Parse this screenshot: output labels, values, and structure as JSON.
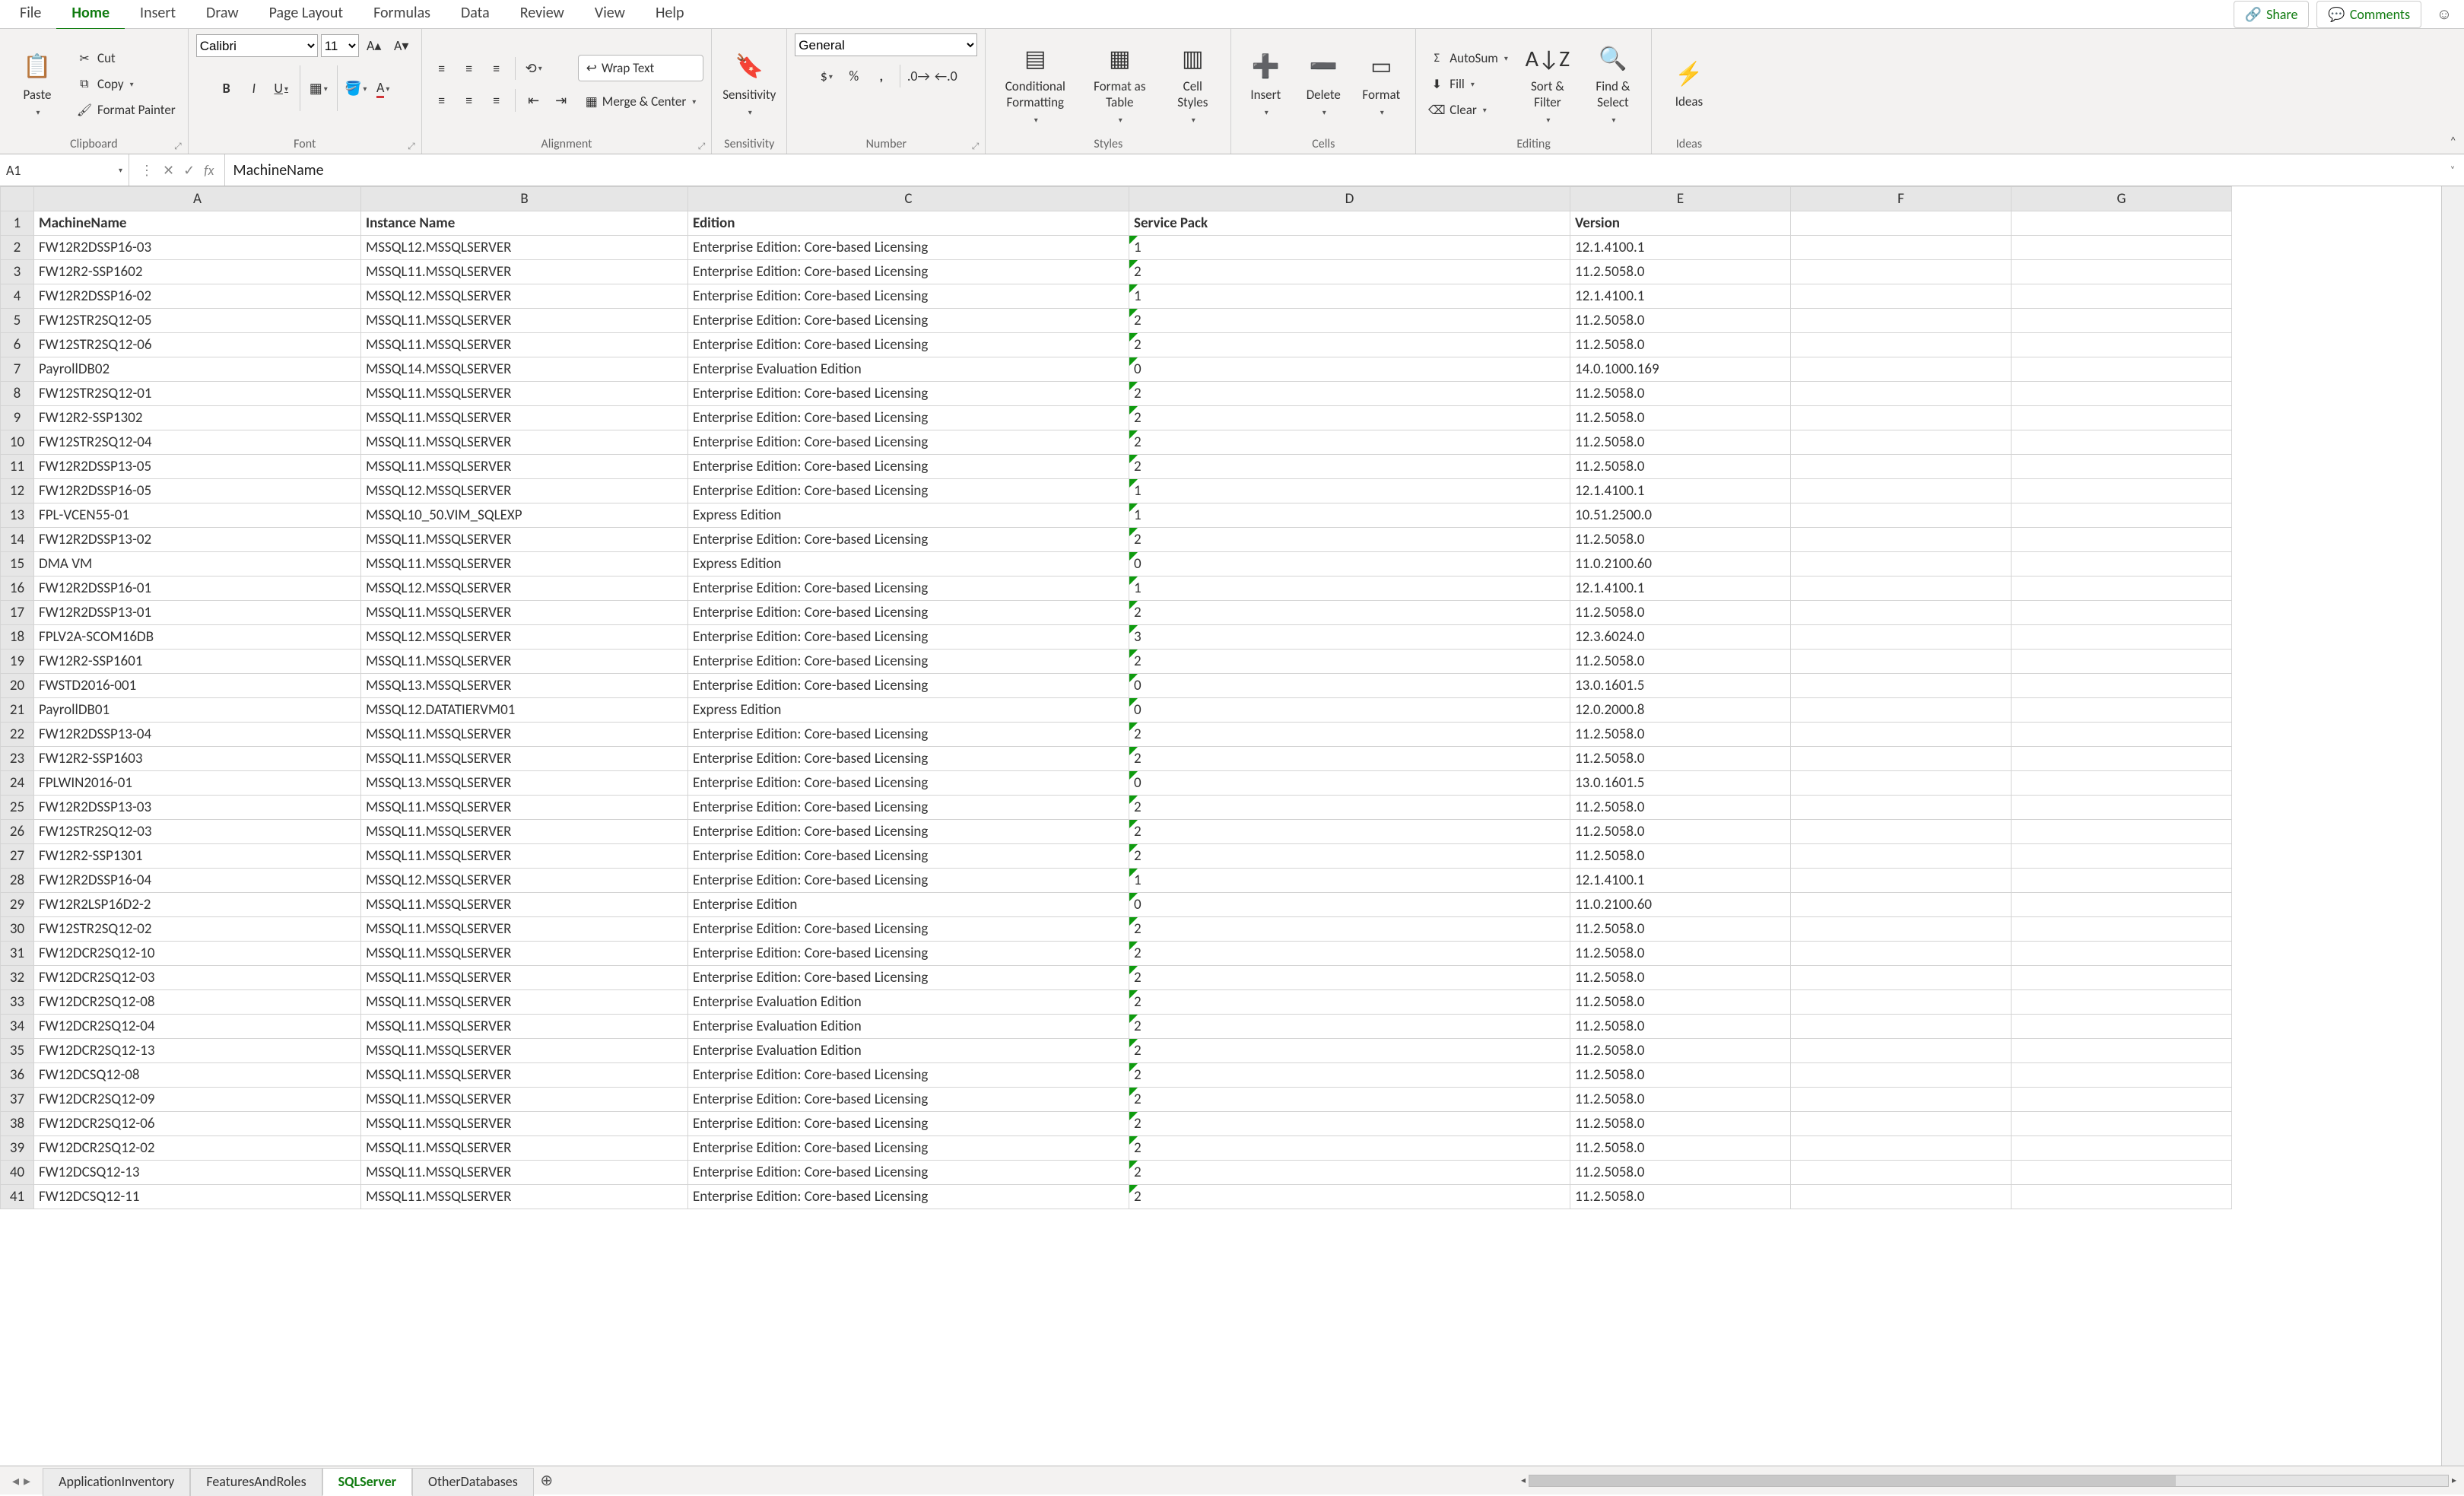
{
  "menu": {
    "tabs": [
      "File",
      "Home",
      "Insert",
      "Draw",
      "Page Layout",
      "Formulas",
      "Data",
      "Review",
      "View",
      "Help"
    ],
    "active": 1,
    "share": "Share",
    "comments": "Comments"
  },
  "ribbon": {
    "clipboard": {
      "title": "Clipboard",
      "paste": "Paste",
      "cut": "Cut",
      "copy": "Copy",
      "format_painter": "Format Painter"
    },
    "font": {
      "title": "Font",
      "name": "Calibri",
      "size": "11"
    },
    "alignment": {
      "title": "Alignment",
      "wrap": "Wrap Text",
      "merge": "Merge & Center"
    },
    "sensitivity": {
      "title": "Sensitivity",
      "label": "Sensitivity"
    },
    "number": {
      "title": "Number",
      "format": "General"
    },
    "styles": {
      "title": "Styles",
      "cond": "Conditional\nFormatting",
      "table": "Format as\nTable",
      "cell": "Cell\nStyles"
    },
    "cells": {
      "title": "Cells",
      "insert": "Insert",
      "delete": "Delete",
      "format": "Format"
    },
    "editing": {
      "title": "Editing",
      "sum": "AutoSum",
      "fill": "Fill",
      "clear": "Clear",
      "sort": "Sort &\nFilter",
      "find": "Find &\nSelect"
    },
    "ideas": {
      "title": "Ideas",
      "label": "Ideas"
    }
  },
  "formula_bar": {
    "cell_ref": "A1",
    "formula": "MachineName"
  },
  "columns": [
    "A",
    "B",
    "C",
    "D",
    "E",
    "F",
    "G"
  ],
  "headers": [
    "MachineName",
    "Instance Name",
    "Edition",
    "Service Pack",
    "Version"
  ],
  "rows": [
    [
      "FW12R2DSSP16-03",
      "MSSQL12.MSSQLSERVER",
      "Enterprise Edition: Core-based Licensing",
      "1",
      "12.1.4100.1"
    ],
    [
      "FW12R2-SSP1602",
      "MSSQL11.MSSQLSERVER",
      "Enterprise Edition: Core-based Licensing",
      "2",
      "11.2.5058.0"
    ],
    [
      "FW12R2DSSP16-02",
      "MSSQL12.MSSQLSERVER",
      "Enterprise Edition: Core-based Licensing",
      "1",
      "12.1.4100.1"
    ],
    [
      "FW12STR2SQ12-05",
      "MSSQL11.MSSQLSERVER",
      "Enterprise Edition: Core-based Licensing",
      "2",
      "11.2.5058.0"
    ],
    [
      "FW12STR2SQ12-06",
      "MSSQL11.MSSQLSERVER",
      "Enterprise Edition: Core-based Licensing",
      "2",
      "11.2.5058.0"
    ],
    [
      "PayrollDB02",
      "MSSQL14.MSSQLSERVER",
      "Enterprise Evaluation Edition",
      "0",
      "14.0.1000.169"
    ],
    [
      "FW12STR2SQ12-01",
      "MSSQL11.MSSQLSERVER",
      "Enterprise Edition: Core-based Licensing",
      "2",
      "11.2.5058.0"
    ],
    [
      "FW12R2-SSP1302",
      "MSSQL11.MSSQLSERVER",
      "Enterprise Edition: Core-based Licensing",
      "2",
      "11.2.5058.0"
    ],
    [
      "FW12STR2SQ12-04",
      "MSSQL11.MSSQLSERVER",
      "Enterprise Edition: Core-based Licensing",
      "2",
      "11.2.5058.0"
    ],
    [
      "FW12R2DSSP13-05",
      "MSSQL11.MSSQLSERVER",
      "Enterprise Edition: Core-based Licensing",
      "2",
      "11.2.5058.0"
    ],
    [
      "FW12R2DSSP16-05",
      "MSSQL12.MSSQLSERVER",
      "Enterprise Edition: Core-based Licensing",
      "1",
      "12.1.4100.1"
    ],
    [
      "FPL-VCEN55-01",
      "MSSQL10_50.VIM_SQLEXP",
      "Express Edition",
      "1",
      "10.51.2500.0"
    ],
    [
      "FW12R2DSSP13-02",
      "MSSQL11.MSSQLSERVER",
      "Enterprise Edition: Core-based Licensing",
      "2",
      "11.2.5058.0"
    ],
    [
      "DMA VM",
      "MSSQL11.MSSQLSERVER",
      "Express Edition",
      "0",
      "11.0.2100.60"
    ],
    [
      "FW12R2DSSP16-01",
      "MSSQL12.MSSQLSERVER",
      "Enterprise Edition: Core-based Licensing",
      "1",
      "12.1.4100.1"
    ],
    [
      "FW12R2DSSP13-01",
      "MSSQL11.MSSQLSERVER",
      "Enterprise Edition: Core-based Licensing",
      "2",
      "11.2.5058.0"
    ],
    [
      "FPLV2A-SCOM16DB",
      "MSSQL12.MSSQLSERVER",
      "Enterprise Edition: Core-based Licensing",
      "3",
      "12.3.6024.0"
    ],
    [
      "FW12R2-SSP1601",
      "MSSQL11.MSSQLSERVER",
      "Enterprise Edition: Core-based Licensing",
      "2",
      "11.2.5058.0"
    ],
    [
      "FWSTD2016-001",
      "MSSQL13.MSSQLSERVER",
      "Enterprise Edition: Core-based Licensing",
      "0",
      "13.0.1601.5"
    ],
    [
      "PayrollDB01",
      "MSSQL12.DATATIERVM01",
      "Express Edition",
      "0",
      "12.0.2000.8"
    ],
    [
      "FW12R2DSSP13-04",
      "MSSQL11.MSSQLSERVER",
      "Enterprise Edition: Core-based Licensing",
      "2",
      "11.2.5058.0"
    ],
    [
      "FW12R2-SSP1603",
      "MSSQL11.MSSQLSERVER",
      "Enterprise Edition: Core-based Licensing",
      "2",
      "11.2.5058.0"
    ],
    [
      "FPLWIN2016-01",
      "MSSQL13.MSSQLSERVER",
      "Enterprise Edition: Core-based Licensing",
      "0",
      "13.0.1601.5"
    ],
    [
      "FW12R2DSSP13-03",
      "MSSQL11.MSSQLSERVER",
      "Enterprise Edition: Core-based Licensing",
      "2",
      "11.2.5058.0"
    ],
    [
      "FW12STR2SQ12-03",
      "MSSQL11.MSSQLSERVER",
      "Enterprise Edition: Core-based Licensing",
      "2",
      "11.2.5058.0"
    ],
    [
      "FW12R2-SSP1301",
      "MSSQL11.MSSQLSERVER",
      "Enterprise Edition: Core-based Licensing",
      "2",
      "11.2.5058.0"
    ],
    [
      "FW12R2DSSP16-04",
      "MSSQL12.MSSQLSERVER",
      "Enterprise Edition: Core-based Licensing",
      "1",
      "12.1.4100.1"
    ],
    [
      "FW12R2LSP16D2-2",
      "MSSQL11.MSSQLSERVER",
      "Enterprise Edition",
      "0",
      "11.0.2100.60"
    ],
    [
      "FW12STR2SQ12-02",
      "MSSQL11.MSSQLSERVER",
      "Enterprise Edition: Core-based Licensing",
      "2",
      "11.2.5058.0"
    ],
    [
      "FW12DCR2SQ12-10",
      "MSSQL11.MSSQLSERVER",
      "Enterprise Edition: Core-based Licensing",
      "2",
      "11.2.5058.0"
    ],
    [
      "FW12DCR2SQ12-03",
      "MSSQL11.MSSQLSERVER",
      "Enterprise Edition: Core-based Licensing",
      "2",
      "11.2.5058.0"
    ],
    [
      "FW12DCR2SQ12-08",
      "MSSQL11.MSSQLSERVER",
      "Enterprise Evaluation Edition",
      "2",
      "11.2.5058.0"
    ],
    [
      "FW12DCR2SQ12-04",
      "MSSQL11.MSSQLSERVER",
      "Enterprise Evaluation Edition",
      "2",
      "11.2.5058.0"
    ],
    [
      "FW12DCR2SQ12-13",
      "MSSQL11.MSSQLSERVER",
      "Enterprise Evaluation Edition",
      "2",
      "11.2.5058.0"
    ],
    [
      "FW12DCSQ12-08",
      "MSSQL11.MSSQLSERVER",
      "Enterprise Edition: Core-based Licensing",
      "2",
      "11.2.5058.0"
    ],
    [
      "FW12DCR2SQ12-09",
      "MSSQL11.MSSQLSERVER",
      "Enterprise Edition: Core-based Licensing",
      "2",
      "11.2.5058.0"
    ],
    [
      "FW12DCR2SQ12-06",
      "MSSQL11.MSSQLSERVER",
      "Enterprise Edition: Core-based Licensing",
      "2",
      "11.2.5058.0"
    ],
    [
      "FW12DCR2SQ12-02",
      "MSSQL11.MSSQLSERVER",
      "Enterprise Edition: Core-based Licensing",
      "2",
      "11.2.5058.0"
    ],
    [
      "FW12DCSQ12-13",
      "MSSQL11.MSSQLSERVER",
      "Enterprise Edition: Core-based Licensing",
      "2",
      "11.2.5058.0"
    ],
    [
      "FW12DCSQ12-11",
      "MSSQL11.MSSQLSERVER",
      "Enterprise Edition: Core-based Licensing",
      "2",
      "11.2.5058.0"
    ]
  ],
  "sheets": {
    "tabs": [
      "ApplicationInventory",
      "FeaturesAndRoles",
      "SQLServer",
      "OtherDatabases"
    ],
    "active": 2
  }
}
